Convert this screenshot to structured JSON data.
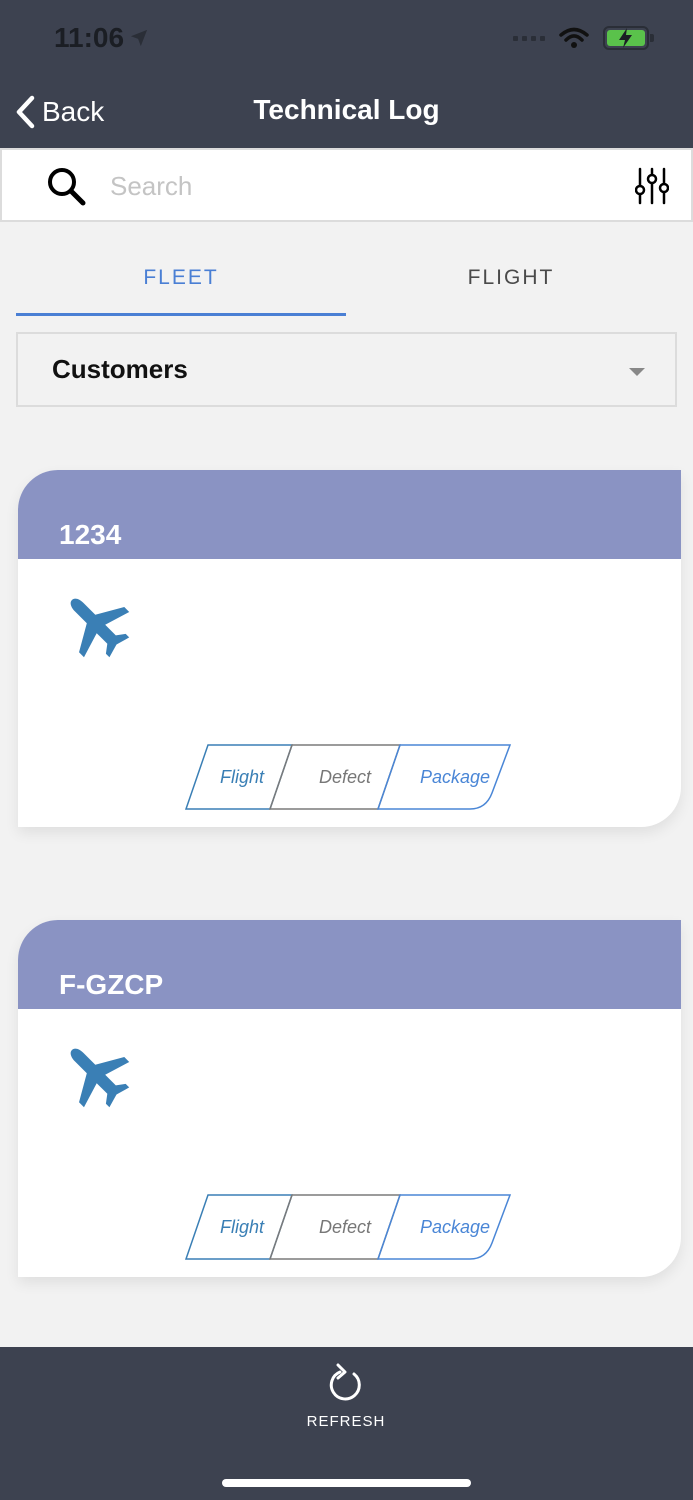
{
  "status_bar": {
    "time": "11:06"
  },
  "nav": {
    "back_label": "Back",
    "title": "Technical Log"
  },
  "search": {
    "placeholder": "Search"
  },
  "tabs": [
    {
      "label": "FLEET",
      "active": true
    },
    {
      "label": "FLIGHT",
      "active": false
    }
  ],
  "filter": {
    "selected": "Customers"
  },
  "aircraft": [
    {
      "registration": "1234",
      "buttons": {
        "flight": "Flight",
        "defect": "Defect",
        "package": "Package"
      }
    },
    {
      "registration": "F-GZCP",
      "buttons": {
        "flight": "Flight",
        "defect": "Defect",
        "package": "Package"
      }
    }
  ],
  "bottom": {
    "refresh_label": "REFRESH"
  },
  "colors": {
    "header_bg": "#3d4250",
    "card_header": "#8a93c3",
    "accent": "#4a7fd4",
    "plane_icon": "#3a7fb5",
    "battery": "#5ac24b"
  },
  "icons": [
    "location-arrow-icon",
    "wifi-icon",
    "battery-charging-icon",
    "chevron-left-icon",
    "search-icon",
    "sliders-icon",
    "airplane-icon",
    "refresh-icon"
  ]
}
